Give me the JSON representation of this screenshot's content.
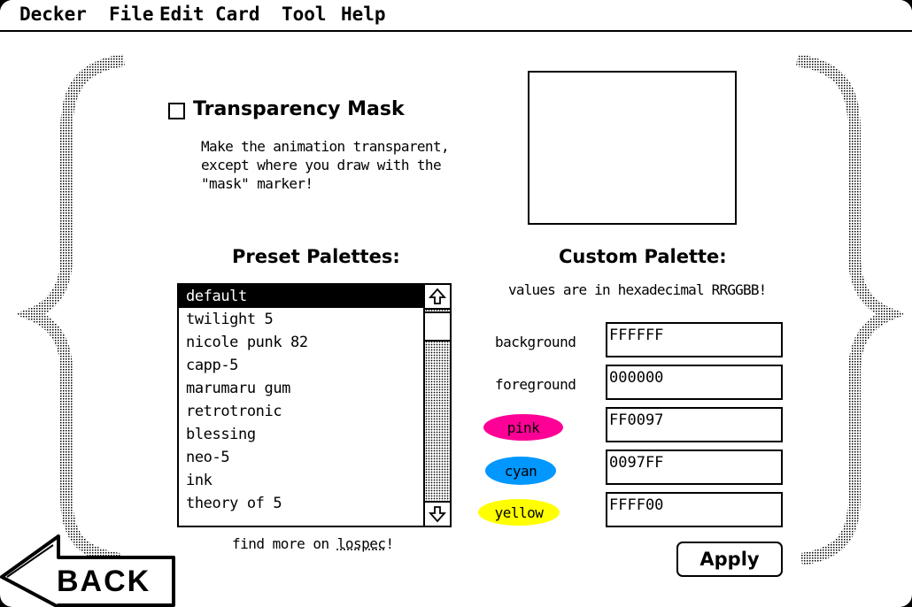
{
  "menu": [
    "Decker",
    "File",
    "Edit",
    "Card",
    "Tool",
    "Help"
  ],
  "mask": {
    "checked": false,
    "title": "Transparency Mask",
    "description": "Make the animation transparent,\nexcept where you draw with the\n\"mask\" marker!"
  },
  "preset": {
    "title": "Preset Palettes:",
    "items": [
      "default",
      "twilight 5",
      "nicole punk 82",
      "capp-5",
      "marumaru gum",
      "retrotronic",
      "blessing",
      "neo-5",
      "ink",
      "theory of 5"
    ],
    "selected_index": 0,
    "find_more_prefix": "find more on ",
    "find_more_link": "lospec",
    "find_more_suffix": "!"
  },
  "custom": {
    "title": "Custom Palette:",
    "note": "values are in hexadecimal RRGGBB!",
    "colors": [
      {
        "label": "background",
        "value": "FFFFFF",
        "swatch": null
      },
      {
        "label": "foreground",
        "value": "000000",
        "swatch": null
      },
      {
        "label": "pink",
        "value": "FF0097",
        "swatch": "#ff0097"
      },
      {
        "label": "cyan",
        "value": "0097FF",
        "swatch": "#0097ff"
      },
      {
        "label": "yellow",
        "value": "FFFF00",
        "swatch": "#ffff00"
      }
    ]
  },
  "apply_label": "Apply",
  "back_label": "BACK"
}
